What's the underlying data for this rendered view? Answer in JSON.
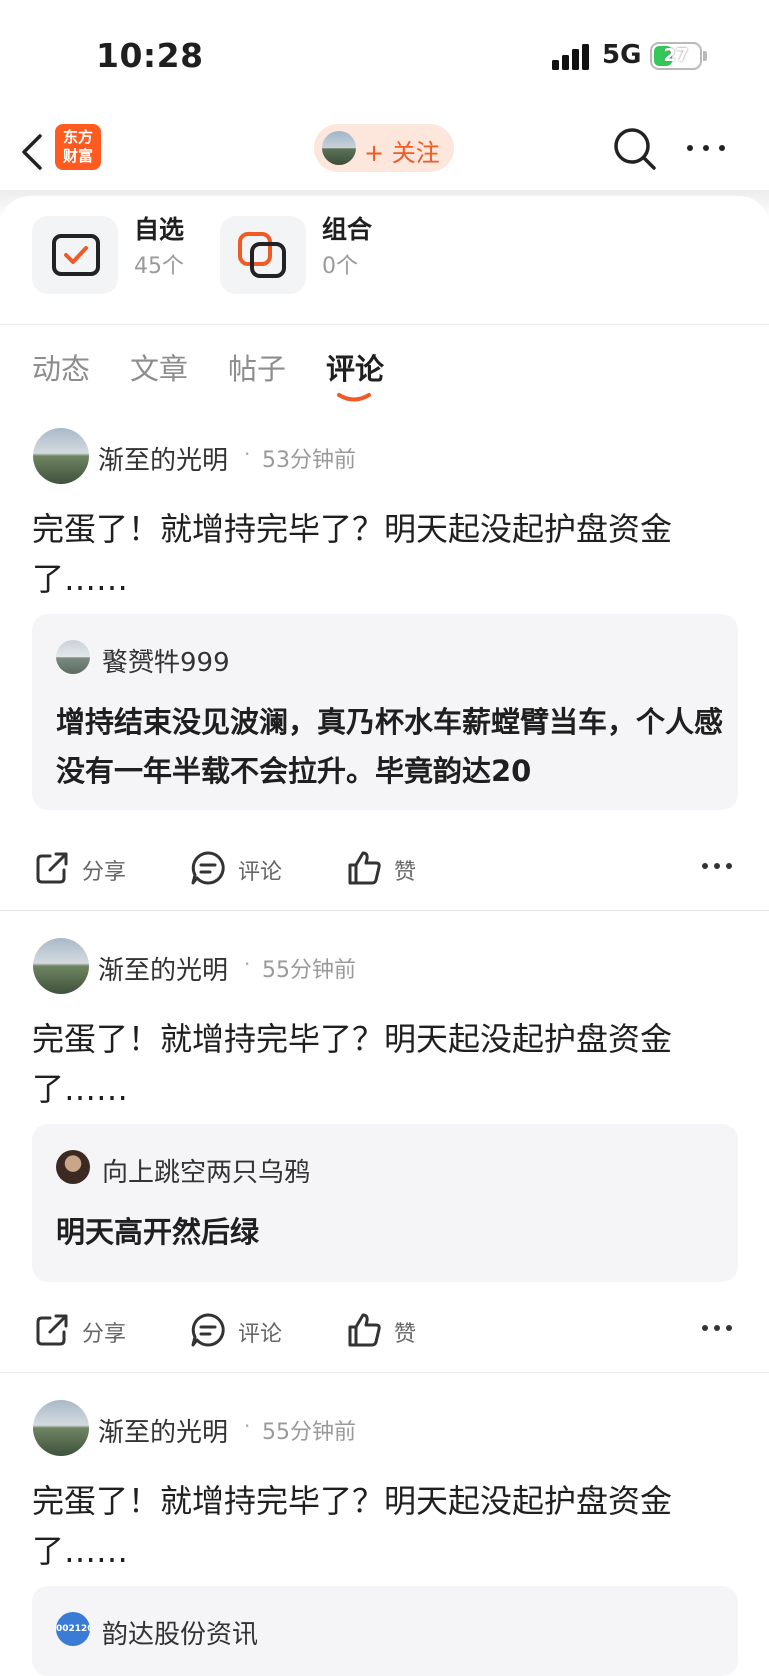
{
  "status_bar": {
    "time": "10:28",
    "network": "5G",
    "battery": "27"
  },
  "nav": {
    "logo_text": "东方财富",
    "follow_label": "+ 关注"
  },
  "tools": [
    {
      "label": "自选",
      "count": "45个",
      "icon": "checkbox-icon"
    },
    {
      "label": "组合",
      "count": "0个",
      "icon": "portfolio-icon"
    }
  ],
  "tabs": [
    {
      "label": "动态",
      "active": false
    },
    {
      "label": "文章",
      "active": false
    },
    {
      "label": "帖子",
      "active": false
    },
    {
      "label": "评论",
      "active": true
    }
  ],
  "actions": {
    "share": "分享",
    "comment": "评论",
    "like": "赞"
  },
  "posts": [
    {
      "author": "渐至的光明",
      "time": "53分钟前",
      "content": "完蛋了！就增持完毕了？明天起没起护盘资金了……",
      "quote_author": "饏赟牪999",
      "quote_text": "增持结束没见波澜，真乃杯水车薪螳臂当车，个人感没有一年半载不会拉升。毕竟韵达20"
    },
    {
      "author": "渐至的光明",
      "time": "55分钟前",
      "content": "完蛋了！就增持完毕了？明天起没起护盘资金了……",
      "quote_author": "向上跳空两只乌鸦",
      "quote_text": "明天高开然后绿"
    },
    {
      "author": "渐至的光明",
      "time": "55分钟前",
      "content": "完蛋了！就增持完毕了？明天起没起护盘资金了……",
      "quote_author": "韵达股份资讯",
      "quote_badge": "002120"
    }
  ],
  "colors": {
    "accent": "#f05a24",
    "brand": "#ff5a1f",
    "quote_bg": "#f5f5f7",
    "battery": "#34c759"
  }
}
